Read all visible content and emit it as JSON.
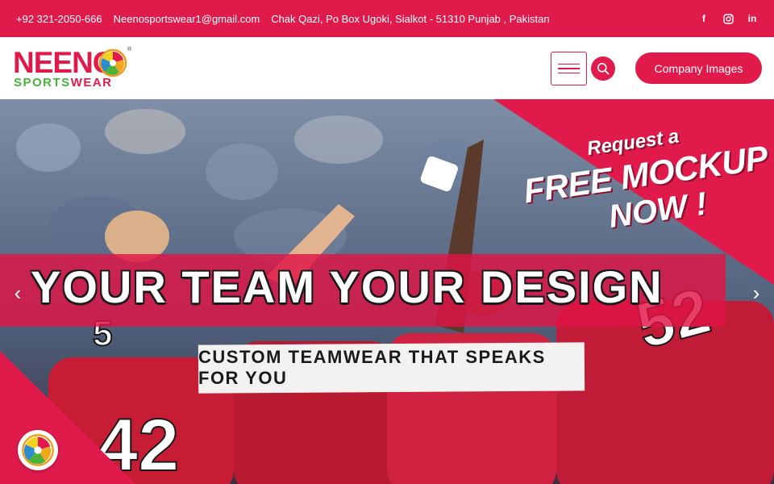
{
  "topbar": {
    "phone": "+92 321-2050-666",
    "email": "Neenosportswear1@gmail.com",
    "address": "Chak Qazi, Po Box Ugoki, Sialkot - 51310 Punjab , Pakistan",
    "socials": [
      {
        "icon": "facebook-icon",
        "glyph": "f"
      },
      {
        "icon": "instagram-icon",
        "glyph": "◎"
      },
      {
        "icon": "linkedin-icon",
        "glyph": "in"
      }
    ]
  },
  "header": {
    "logo_top": "NEENO",
    "logo_bottom_green": "SPORTS",
    "logo_bottom_red": "WEAR",
    "logo_reg": "®",
    "company_button": "Company Images"
  },
  "hero": {
    "title": "YOUR TEAM YOUR DESIGN",
    "subtitle": "CUSTOM TEAMWEAR THAT SPEAKS FOR YOU",
    "promo_line1": "Request a",
    "promo_line2": "FREE MOCKUP",
    "promo_line3": "NOW !",
    "prev_arrow": "‹",
    "next_arrow": "›",
    "jersey_numbers": [
      "42",
      "52",
      "5"
    ]
  },
  "colors": {
    "brand": "#e01b4c",
    "brand_green": "#49b33a",
    "white": "#ffffff"
  }
}
